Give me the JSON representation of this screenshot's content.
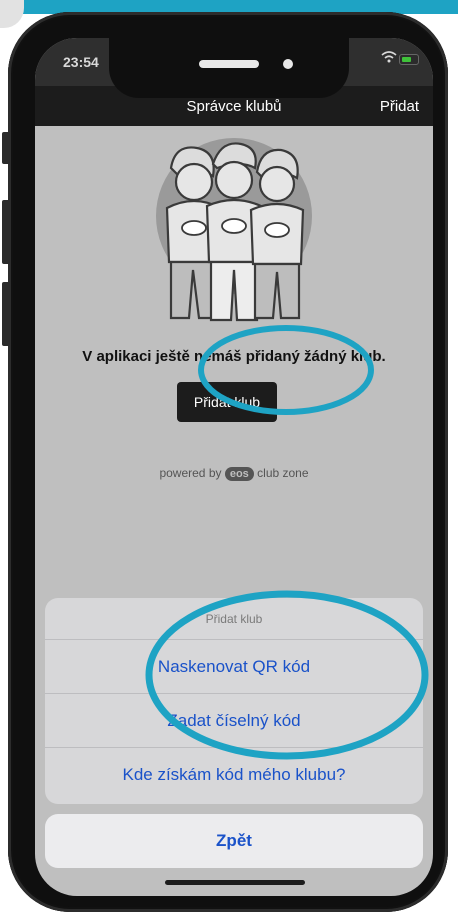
{
  "status_bar": {
    "time": "23:54",
    "wifi_icon": "wifi-icon",
    "battery_icon": "battery-icon"
  },
  "nav": {
    "title": "Správce klubů",
    "action_label": "Přidat"
  },
  "empty_state": {
    "illustration": "three-people-illustration",
    "message": "V aplikaci ještě nemáš přidaný žádný klub.",
    "button_label": "Přidat klub"
  },
  "powered_by": {
    "prefix": "powered by",
    "logo_text": "eos",
    "suffix": "club zone"
  },
  "action_sheet": {
    "title": "Přidat klub",
    "options": [
      "Naskenovat QR kód",
      "Zadat číselný kód",
      "Kde získám kód mého klubu?"
    ],
    "cancel_label": "Zpět"
  },
  "colors": {
    "accent": "#1ea3c4",
    "link": "#1a52c9",
    "nav_bg": "#1c1c1c"
  }
}
